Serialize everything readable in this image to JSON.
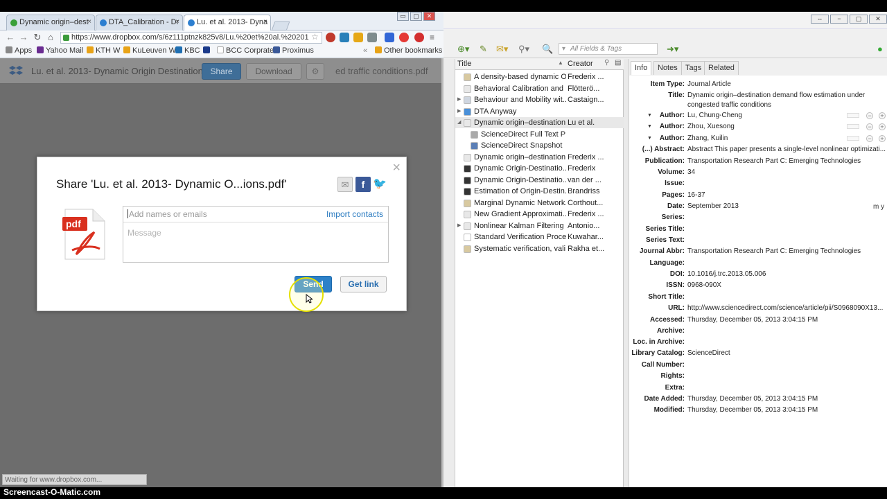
{
  "browser": {
    "tabs": [
      {
        "label": "Dynamic origin–dest",
        "close": "×"
      },
      {
        "label": "DTA_Calibration - Dr",
        "close": "×"
      },
      {
        "label": "Lu. et al. 2013- Dyna",
        "close": "×"
      }
    ],
    "window_buttons": [
      "▭",
      "▢",
      "✕"
    ],
    "url": "https://www.dropbox.com/s/6z111ptnzk825v8/Lu.%20et%20al.%20201",
    "bookmarks": [
      "Apps",
      "Yahoo Mail",
      "KTH W",
      "KuLeuven W",
      "KBC",
      "BCC Corprate",
      "Proximus",
      "Other bookmarks"
    ],
    "status": "Waiting for www.dropbox.com..."
  },
  "dropbox": {
    "file_title": "Lu. et al. 2013- Dynamic Origin Destination",
    "share_label": "Share",
    "download_label": "Download",
    "overlay_text": "ed traffic conditions.pdf"
  },
  "share_dialog": {
    "title": "Share 'Lu. et al. 2013- Dynamic O...ions.pdf'",
    "close": "×",
    "names_placeholder": "Add names or emails",
    "import_label": "Import contacts",
    "message_placeholder": "Message",
    "send_label": "Send",
    "getlink_label": "Get link",
    "pdf_label": "pdf"
  },
  "zotero": {
    "search_placeholder": "All Fields & Tags",
    "columns": {
      "title": "Title",
      "creator": "Creator"
    },
    "items": [
      {
        "title": "A density-based dynamic O...",
        "creator": "Frederix ..."
      },
      {
        "title": "Behavioral Calibration and ...",
        "creator": "Flötterö..."
      },
      {
        "title": "Behaviour and Mobility wit...",
        "creator": "Castaign..."
      },
      {
        "title": "DTA Anyway",
        "creator": ""
      },
      {
        "title": "Dynamic origin–destination...",
        "creator": "Lu et al."
      },
      {
        "title": "ScienceDirect Full Text PDF",
        "creator": ""
      },
      {
        "title": "ScienceDirect Snapshot",
        "creator": ""
      },
      {
        "title": "Dynamic origin–destination...",
        "creator": "Frederix ..."
      },
      {
        "title": "Dynamic Origin-Destinatio...",
        "creator": "Frederix"
      },
      {
        "title": "Dynamic Origin-Destinatio...",
        "creator": "van der ..."
      },
      {
        "title": "Estimation of Origin-Destin...",
        "creator": "Brandriss"
      },
      {
        "title": "Marginal Dynamic Network...",
        "creator": "Corthout..."
      },
      {
        "title": "New Gradient Approximati...",
        "creator": "Frederix ..."
      },
      {
        "title": "Nonlinear Kalman Filtering ...",
        "creator": "Antonio..."
      },
      {
        "title": "Standard Verification Proce...",
        "creator": "Kuwahar..."
      },
      {
        "title": "Systematic verification, vali...",
        "creator": "Rakha et..."
      }
    ],
    "tabs": [
      "Info",
      "Notes",
      "Tags",
      "Related"
    ],
    "fields": [
      {
        "label": "Item Type:",
        "value": "Journal Article"
      },
      {
        "label": "Title:",
        "value": "Dynamic origin–destination demand flow estimation under congested traffic conditions"
      },
      {
        "label": "Author:",
        "value": "Lu, Chung-Cheng"
      },
      {
        "label": "Author:",
        "value": "Zhou, Xuesong"
      },
      {
        "label": "Author:",
        "value": "Zhang, Kuilin"
      },
      {
        "label": "(...) Abstract:",
        "value": "Abstract This paper presents a single-level nonlinear optimizati..."
      },
      {
        "label": "Publication:",
        "value": "Transportation Research Part C: Emerging Technologies"
      },
      {
        "label": "Volume:",
        "value": "34"
      },
      {
        "label": "Issue:",
        "value": ""
      },
      {
        "label": "Pages:",
        "value": "16-37"
      },
      {
        "label": "Date:",
        "value": "September 2013"
      },
      {
        "label": "Series:",
        "value": ""
      },
      {
        "label": "Series Title:",
        "value": ""
      },
      {
        "label": "Series Text:",
        "value": ""
      },
      {
        "label": "Journal Abbr:",
        "value": "Transportation Research Part C: Emerging Technologies"
      },
      {
        "label": "Language:",
        "value": ""
      },
      {
        "label": "DOI:",
        "value": "10.1016/j.trc.2013.05.006"
      },
      {
        "label": "ISSN:",
        "value": "0968-090X"
      },
      {
        "label": "Short Title:",
        "value": ""
      },
      {
        "label": "URL:",
        "value": "http://www.sciencedirect.com/science/article/pii/S0968090X13..."
      },
      {
        "label": "Accessed:",
        "value": "Thursday, December 05, 2013 3:04:15 PM"
      },
      {
        "label": "Archive:",
        "value": ""
      },
      {
        "label": "Loc. in Archive:",
        "value": ""
      },
      {
        "label": "Library Catalog:",
        "value": "ScienceDirect"
      },
      {
        "label": "Call Number:",
        "value": ""
      },
      {
        "label": "Rights:",
        "value": ""
      },
      {
        "label": "Extra:",
        "value": ""
      },
      {
        "label": "Date Added:",
        "value": "Thursday, December 05, 2013 3:04:15 PM"
      },
      {
        "label": "Modified:",
        "value": "Thursday, December 05, 2013 3:04:15 PM"
      }
    ],
    "date_suffix": "m y"
  },
  "watermark": "Screencast-O-Matic.com"
}
